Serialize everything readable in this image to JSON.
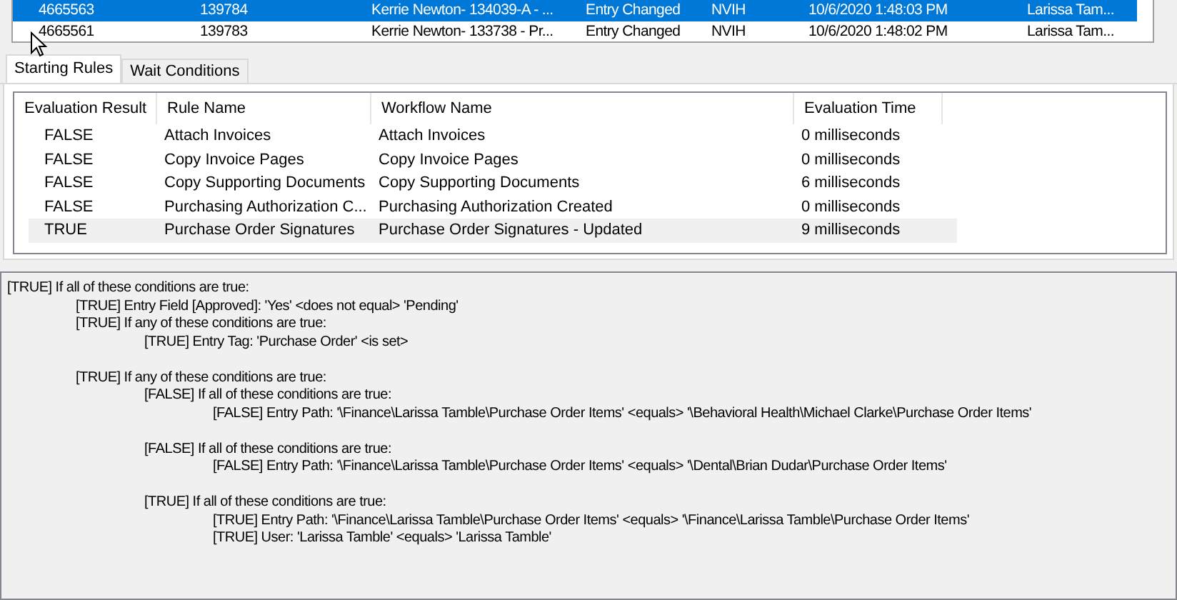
{
  "entries": [
    {
      "cells": [
        "4665563",
        "139784",
        "Kerrie Newton- 134039-A - ...",
        "Entry Changed",
        "NVIH",
        "10/6/2020 1:48:03 PM",
        "Larissa Tam..."
      ],
      "selected": true
    },
    {
      "cells": [
        "4665561",
        "139783",
        "Kerrie Newton- 133738 - Pr...",
        "Entry Changed",
        "NVIH",
        "10/6/2020 1:48:02 PM",
        "Larissa Tam..."
      ],
      "selected": false
    }
  ],
  "tabs": [
    {
      "label": "Starting Rules",
      "selected": true
    },
    {
      "label": "Wait Conditions",
      "selected": false
    }
  ],
  "rules": {
    "columns": [
      "Evaluation Result",
      "Rule Name",
      "Workflow Name",
      "Evaluation Time"
    ],
    "rows": [
      {
        "cells": [
          "FALSE",
          "Attach Invoices",
          "Attach Invoices",
          "0 milliseconds"
        ],
        "selected": false
      },
      {
        "cells": [
          "FALSE",
          "Copy Invoice Pages",
          "Copy Invoice Pages",
          "0 milliseconds"
        ],
        "selected": false
      },
      {
        "cells": [
          "FALSE",
          "Copy Supporting Documents",
          "Copy Supporting Documents",
          "6 milliseconds"
        ],
        "selected": false
      },
      {
        "cells": [
          "FALSE",
          "Purchasing Authorization C...",
          "Purchasing Authorization Created",
          "0 milliseconds"
        ],
        "selected": false
      },
      {
        "cells": [
          "TRUE",
          "Purchase Order Signatures",
          "Purchase Order Signatures - Updated",
          "9 milliseconds"
        ],
        "selected": true
      }
    ]
  },
  "conditions": [
    {
      "text": "[TRUE] If all of these conditions are true:",
      "children": [
        {
          "text": "[TRUE] Entry Field [Approved]:  'Yes' <does not equal> 'Pending'"
        },
        {
          "text": "[TRUE] If any of these conditions are true:",
          "children": [
            {
              "text": "[TRUE] Entry Tag: 'Purchase Order' <is set>"
            }
          ]
        },
        {
          "text": "[TRUE] If any of these conditions are true:",
          "children": [
            {
              "text": "[FALSE] If all of these conditions are true:",
              "children": [
                {
                  "text": "[FALSE] Entry Path: '\\Finance\\Larissa Tamble\\Purchase Order Items' <equals> '\\Behavioral Health\\Michael Clarke\\Purchase Order Items'"
                }
              ]
            },
            {
              "text": "[FALSE] If all of these conditions are true:",
              "children": [
                {
                  "text": "[FALSE] Entry Path: '\\Finance\\Larissa Tamble\\Purchase Order Items' <equals> '\\Dental\\Brian Dudar\\Purchase Order Items'"
                }
              ]
            },
            {
              "text": "[TRUE] If all of these conditions are true:",
              "children": [
                {
                  "text": "[TRUE] Entry Path: '\\Finance\\Larissa Tamble\\Purchase Order Items' <equals> '\\Finance\\Larissa Tamble\\Purchase Order Items'"
                },
                {
                  "text": "[TRUE] User: 'Larissa Tamble' <equals> 'Larissa Tamble'"
                }
              ]
            }
          ]
        }
      ]
    }
  ]
}
